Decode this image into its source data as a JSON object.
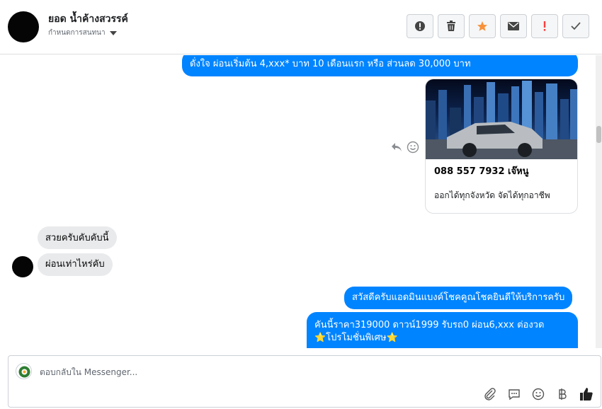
{
  "header": {
    "contact_name": "ยอด น้ำค้างสวรรค์",
    "assign_label": "กำหนดการสนทนา",
    "toolbar": [
      {
        "icon": "alert-circle-icon"
      },
      {
        "icon": "trash-icon"
      },
      {
        "icon": "star-icon",
        "color": "#f7923b"
      },
      {
        "icon": "envelope-icon"
      },
      {
        "icon": "exclamation-icon",
        "color": "#fa3e3e"
      },
      {
        "icon": "checkmark-icon"
      }
    ]
  },
  "messages": {
    "out_1": "ดั่งใจ ผ่อนเริ่มต้น 4,xxx* บาท 10 เดือนแรก หรือ ส่วนลด 30,000 บาท",
    "card": {
      "title": "088 557 7932 เจ๊หนู",
      "subtitle": "ออกได้ทุกจังหวัด จัดได้ทุกอาชีพ"
    },
    "in_1": "สวยครับคับคับนี้",
    "in_2": "ผ่อนเท่าไหร่คับ",
    "out_2": "สวัสดีครับแอดมินแบงค์โชคคูณโชคยินดีให้บริการครับ",
    "out_3_line1": "คันนี้ราคา319000 ดาวน์1999 รับรถ0 ผ่อน6,xxx ต่องวด",
    "out_3_line2": "⭐โปรโมชั่นพิเศษ⭐"
  },
  "composer": {
    "placeholder": "ตอบกลับใน Messenger..."
  },
  "colors": {
    "accent": "#0084ff",
    "incoming_bubble": "#e9eaec"
  }
}
